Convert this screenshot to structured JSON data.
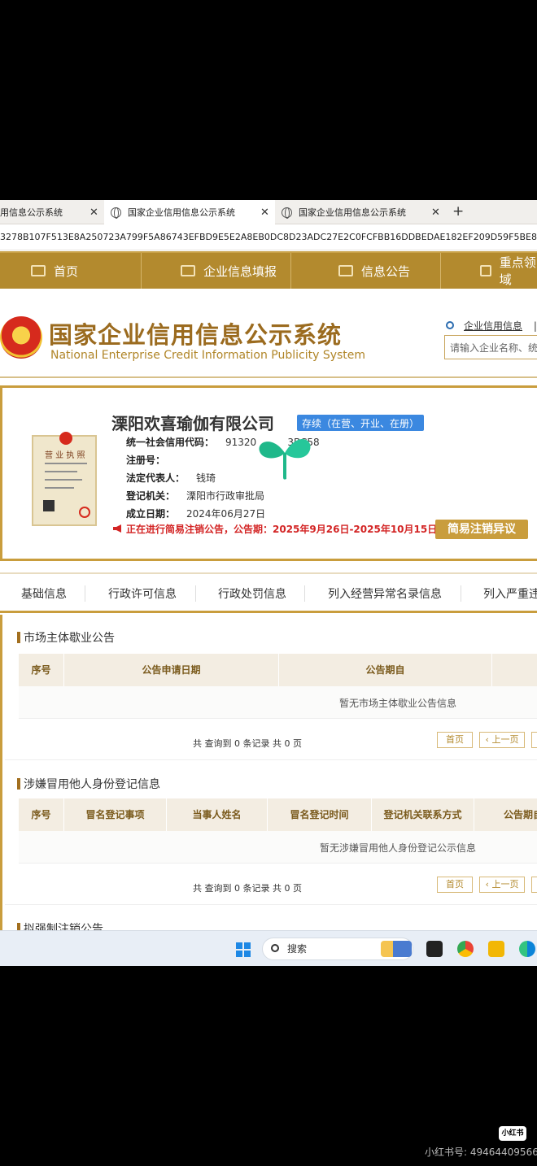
{
  "browser": {
    "tabs": [
      {
        "title": "用信息公示系统"
      },
      {
        "title": "国家企业信用信息公示系统"
      },
      {
        "title": "国家企业信用信息公示系统"
      }
    ],
    "close_glyph": "✕",
    "new_tab_glyph": "+",
    "address": "3278B107F513E8A250723A799F5A86743EFBD9E5E2A8EB0DC8D23ADC27E2C0FCFBB16DDBEDAE182EF209D59F5BE887D0"
  },
  "nav": {
    "items": [
      {
        "label": "首页"
      },
      {
        "label": "企业信息填报"
      },
      {
        "label": "信息公告"
      },
      {
        "label": "重点领域"
      }
    ]
  },
  "header": {
    "title_cn": "国家企业信用信息公示系统",
    "title_en": "National Enterprise Credit Information Publicity System",
    "search_link": "企业信用信息",
    "search_sep": "|",
    "search_placeholder": "请输入企业名称、统"
  },
  "company": {
    "name": "溧阳欢喜瑜伽有限公司",
    "status": "存续（在营、开业、在册）",
    "license_title": "营 业 执 照",
    "fields": [
      {
        "label": "统一社会信用代码：",
        "value": "91320          3BC58"
      },
      {
        "label": "注册号：",
        "value": ""
      },
      {
        "label": "法定代表人：",
        "value": "钱琦"
      },
      {
        "label": "登记机关：",
        "value": "溧阳市行政审批局"
      },
      {
        "label": "成立日期：",
        "value": "2024年06月27日"
      }
    ],
    "notice": "正在进行简易注销公告，公告期：2025年9月26日-2025年10月15日",
    "objection_button": "简易注销异议"
  },
  "subtabs": [
    {
      "label": "基础信息"
    },
    {
      "label": "行政许可信息"
    },
    {
      "label": "行政处罚信息"
    },
    {
      "label": "列入经营异常名录信息"
    },
    {
      "label": "列入严重违"
    }
  ],
  "sections": [
    {
      "title": "市场主体歇业公告",
      "headers": [
        "序号",
        "公告申请日期",
        "公告期自"
      ],
      "empty": "暂无市场主体歇业公告信息",
      "pager": "共 查询到 0 条记录 共 0 页",
      "first": "首页",
      "prev": "‹ 上一页"
    },
    {
      "title": "涉嫌冒用他人身份登记信息",
      "headers": [
        "序号",
        "冒名登记事项",
        "当事人姓名",
        "冒名登记时间",
        "登记机关联系方式",
        "公告期自"
      ],
      "empty": "暂无涉嫌冒用他人身份登记公示信息",
      "pager": "共 查询到 0 条记录 共 0 页",
      "first": "首页",
      "prev": "‹ 上一页"
    },
    {
      "title": "拟强制注销公告"
    }
  ],
  "taskbar": {
    "search_label": "搜索"
  },
  "watermark": {
    "logo": "小红书",
    "text": "小红书号: 49464409566"
  },
  "colors": {
    "gold": "#b38a2e",
    "status_blue": "#3b88e0",
    "notice_red": "#d32525"
  }
}
